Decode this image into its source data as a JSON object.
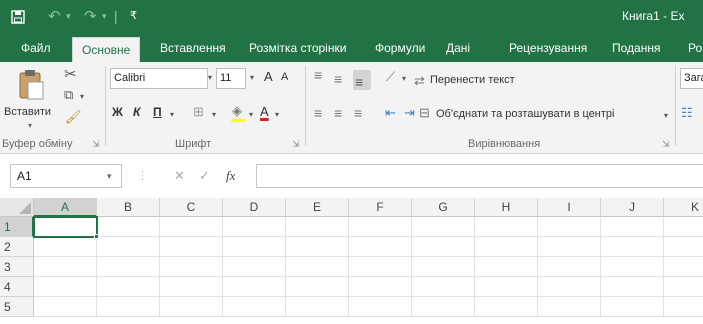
{
  "colors": {
    "accent": "#217346",
    "ribbon_bg": "#f3f3f3"
  },
  "titlebar": {
    "save_icon": "save-icon",
    "undo_icon": "undo-icon",
    "redo_icon": "redo-icon",
    "title": "Книга1 - Ex"
  },
  "tabs": [
    "Файл",
    "Основне",
    "Вставлення",
    "Розмітка сторінки",
    "Формули",
    "Дані",
    "Рецензування",
    "Подання",
    "Ро"
  ],
  "active_tab": "Основне",
  "clipboard": {
    "paste_label": "Вставити",
    "group_label": "Буфер обміну"
  },
  "font": {
    "name": "Calibri",
    "size": "11",
    "increase": "A",
    "decrease": "A",
    "bold": "Ж",
    "italic": "К",
    "underline": "П",
    "color_letter": "A",
    "group_label": "Шрифт"
  },
  "alignment": {
    "wrap_text": "Перенести текст",
    "merge_center": "Об'єднати та розташувати в центрі",
    "group_label": "Вирівнювання"
  },
  "number": {
    "format": "Зага"
  },
  "formula_bar": {
    "name_box": "A1",
    "fx_label": "fx",
    "value": ""
  },
  "grid": {
    "columns": [
      "A",
      "B",
      "C",
      "D",
      "E",
      "F",
      "G",
      "H",
      "I",
      "J",
      "K"
    ],
    "rows": [
      "1",
      "2",
      "3",
      "4",
      "5"
    ],
    "selected_cell": "A1"
  }
}
